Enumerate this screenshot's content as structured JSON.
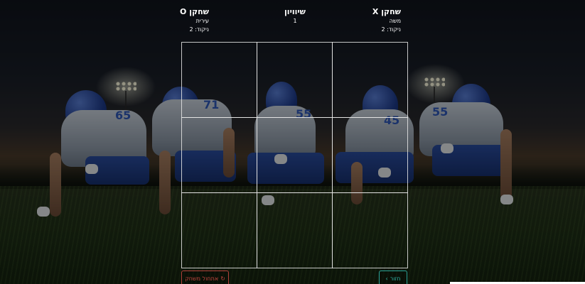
{
  "scoreboard": {
    "player_x": {
      "title": "שחקן X",
      "name": "משה",
      "score": "ניקוד: 2"
    },
    "draws": {
      "title": "שיוויון",
      "count": "1"
    },
    "player_o": {
      "title": "שחקן O",
      "name": "עירית",
      "score": "ניקוד: 2"
    }
  },
  "board": {
    "cells": [
      "",
      "",
      "",
      "",
      "",
      "",
      "",
      "",
      ""
    ]
  },
  "buttons": {
    "reset_label": "אתחול משחק",
    "reset_icon": "reload-icon",
    "back_label": "חזור",
    "back_icon": "chevron-right-icon"
  },
  "colors": {
    "reset": "#c2473f",
    "back": "#2fb3a6",
    "grid_lines": "#e6e6e6",
    "text": "#ffffff"
  }
}
